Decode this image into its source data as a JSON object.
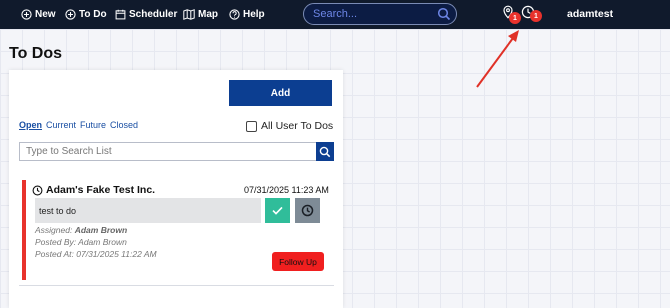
{
  "nav": {
    "new_label": "New",
    "todo_label": "To Do",
    "scheduler_label": "Scheduler",
    "map_label": "Map",
    "help_label": "Help",
    "search_placeholder": "Search...",
    "location_badge": "1",
    "reminder_badge": "1",
    "username": "adamtest"
  },
  "page": {
    "title": "To Dos",
    "add_label": "Add",
    "filters": [
      "Open",
      "Current",
      "Future",
      "Closed"
    ],
    "active_filter": "Open",
    "all_users_label": "All User To Dos",
    "list_search_placeholder": "Type to Search List"
  },
  "todo_item": {
    "company": "Adam's Fake Test Inc.",
    "datetime": "07/31/2025 11:23 AM",
    "note": "test to do",
    "assigned_label": "Assigned:",
    "assigned_to": "Adam Brown",
    "posted_by": "Posted By: Adam Brown",
    "posted_at": "Posted At: 07/31/2025 11:22 AM",
    "follow_up_label": "Follow Up"
  },
  "colors": {
    "topbar": "#101a2c",
    "primary": "#0c3e91",
    "accent_red": "#e8322c",
    "done_green": "#30bd9a",
    "snooze_gray": "#7e8b96"
  }
}
